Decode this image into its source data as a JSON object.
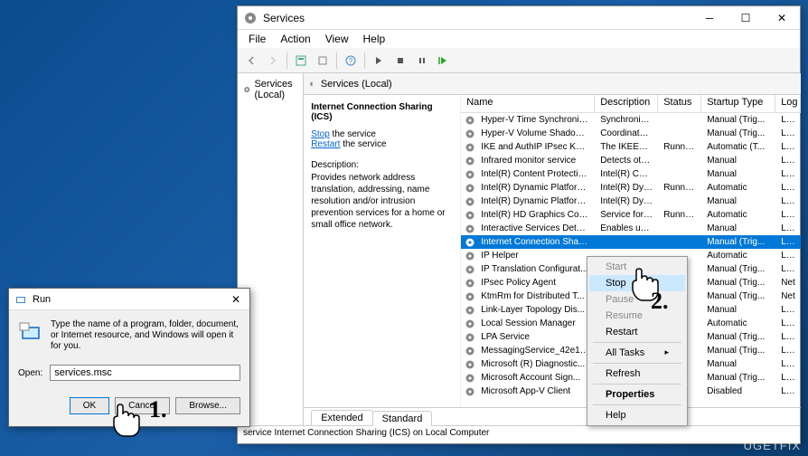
{
  "services_window": {
    "title": "Services",
    "menu": [
      "File",
      "Action",
      "View",
      "Help"
    ],
    "left_panel_label": "Services (Local)",
    "panel_header": "Services (Local)",
    "detail": {
      "title": "Internet Connection Sharing (ICS)",
      "stop_link": "Stop",
      "stop_suffix": " the service",
      "restart_link": "Restart",
      "restart_suffix": " the service",
      "desc_label": "Description:",
      "desc": "Provides network address translation, addressing, name resolution and/or intrusion prevention services for a home or small office network."
    },
    "columns": {
      "name": "Name",
      "desc": "Description",
      "status": "Status",
      "startup": "Startup Type",
      "log": "Log"
    },
    "rows": [
      {
        "name": "Hyper-V Time Synchronizat...",
        "desc": "Synchronize...",
        "status": "",
        "startup": "Manual (Trig...",
        "log": "Loc"
      },
      {
        "name": "Hyper-V Volume Shadow C...",
        "desc": "Coordinates...",
        "status": "",
        "startup": "Manual (Trig...",
        "log": "Loc"
      },
      {
        "name": "IKE and AuthIP IPsec Keying...",
        "desc": "The IKEEXT ...",
        "status": "Running",
        "startup": "Automatic (T...",
        "log": "Loc"
      },
      {
        "name": "Infrared monitor service",
        "desc": "Detects oth...",
        "status": "",
        "startup": "Manual",
        "log": "Loc"
      },
      {
        "name": "Intel(R) Content Protection ...",
        "desc": "Intel(R) Con...",
        "status": "",
        "startup": "Manual",
        "log": "Loc"
      },
      {
        "name": "Intel(R) Dynamic Platform a...",
        "desc": "Intel(R) Dyn...",
        "status": "Running",
        "startup": "Automatic",
        "log": "Loc"
      },
      {
        "name": "Intel(R) Dynamic Platform a...",
        "desc": "Intel(R) Dyn...",
        "status": "",
        "startup": "Manual",
        "log": "Loc"
      },
      {
        "name": "Intel(R) HD Graphics Contro...",
        "desc": "Service for I...",
        "status": "Running",
        "startup": "Automatic",
        "log": "Loc"
      },
      {
        "name": "Interactive Services Detection",
        "desc": "Enables use...",
        "status": "",
        "startup": "Manual",
        "log": "Loc"
      },
      {
        "name": "Internet Connection Shari...",
        "desc": "",
        "status": "",
        "startup": "Manual (Trig...",
        "log": "Loc",
        "selected": true
      },
      {
        "name": "IP Helper",
        "desc": "",
        "status": "",
        "startup": "Automatic",
        "log": "Loc"
      },
      {
        "name": "IP Translation Configurat...",
        "desc": "",
        "status": "",
        "startup": "Manual (Trig...",
        "log": "Loc"
      },
      {
        "name": "IPsec Policy Agent",
        "desc": "",
        "status": "",
        "startup": "Manual (Trig...",
        "log": "Net"
      },
      {
        "name": "KtmRm for Distributed T...",
        "desc": "",
        "status": "",
        "startup": "Manual (Trig...",
        "log": "Net"
      },
      {
        "name": "Link-Layer Topology Dis...",
        "desc": "",
        "status": "",
        "startup": "Manual",
        "log": "Loc"
      },
      {
        "name": "Local Session Manager",
        "desc": "",
        "status": "",
        "startup": "Automatic",
        "log": "Loc"
      },
      {
        "name": "LPA Service",
        "desc": "",
        "status": "",
        "startup": "Manual (Trig...",
        "log": "Loc"
      },
      {
        "name": "MessagingService_42e10...",
        "desc": "",
        "status": "",
        "startup": "Manual (Trig...",
        "log": "Loc"
      },
      {
        "name": "Microsoft (R) Diagnostic...",
        "desc": "",
        "status": "",
        "startup": "Manual",
        "log": "Loc"
      },
      {
        "name": "Microsoft Account Sign...",
        "desc": "",
        "status": "",
        "startup": "Manual (Trig...",
        "log": "Loc"
      },
      {
        "name": "Microsoft App-V Client",
        "desc": "",
        "status": "",
        "startup": "Disabled",
        "log": "Loc"
      }
    ],
    "tabs": {
      "extended": "Extended",
      "standard": "Standard"
    },
    "statusbar": "service Internet Connection Sharing (ICS) on Local Computer"
  },
  "context_menu": {
    "start": "Start",
    "stop": "Stop",
    "pause": "Pause",
    "resume": "Resume",
    "restart": "Restart",
    "all_tasks": "All Tasks",
    "refresh": "Refresh",
    "properties": "Properties",
    "help": "Help"
  },
  "run_dialog": {
    "title": "Run",
    "desc": "Type the name of a program, folder, document, or Internet resource, and Windows will open it for you.",
    "open_label": "Open:",
    "input_value": "services.msc",
    "ok": "OK",
    "cancel": "Cancel",
    "browse": "Browse..."
  },
  "steps": {
    "one": "1.",
    "two": "2."
  },
  "watermark": "UGETFIX"
}
